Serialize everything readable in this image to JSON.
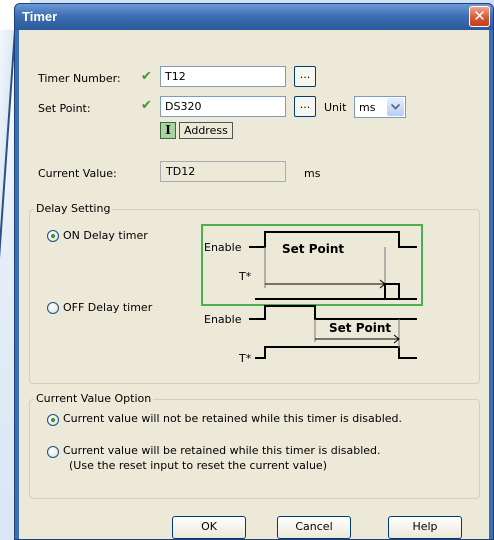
{
  "window": {
    "title": "Timer"
  },
  "timer_number": {
    "label": "Timer Number:",
    "value": "T12",
    "browse_label": "..."
  },
  "set_point": {
    "label": "Set Point:",
    "value": "DS320",
    "browse_label": "...",
    "unit_label": "Unit",
    "unit_value": "ms",
    "address_icon_text": "I",
    "address_label": "Address"
  },
  "current_value": {
    "label": "Current Value:",
    "value": "TD12",
    "unit": "ms"
  },
  "delay_setting": {
    "legend": "Delay Setting",
    "on_label": "ON Delay timer",
    "off_label": "OFF Delay timer",
    "selected": "on",
    "diagram": {
      "enable_label": "Enable",
      "tstar_label": "T*",
      "setpoint_label": "Set Point"
    }
  },
  "current_value_option": {
    "legend": "Current Value Option",
    "option1": "Current value will not be retained while this timer is disabled.",
    "option2_line1": "Current value will be retained while this timer is disabled.",
    "option2_line2": "(Use the reset input to reset the current value)",
    "selected": "option1"
  },
  "buttons": {
    "ok": "OK",
    "cancel": "Cancel",
    "help": "Help"
  },
  "colors": {
    "check": "#3c9a2d",
    "highlight_box": "#4caf50",
    "title_bar": "#3d6fb4"
  }
}
